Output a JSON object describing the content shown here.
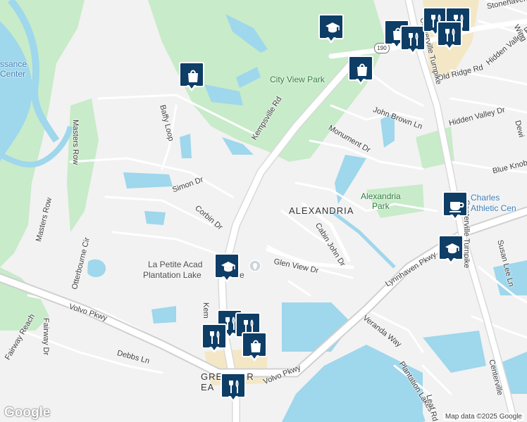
{
  "map": {
    "colors": {
      "water": "#9fd7ec",
      "park": "#c8ebc9",
      "road": "#ffffff",
      "highway": "#cfcfcf",
      "commercial": "#f3e7c6",
      "marker": "#0e3d66",
      "background": "#f2f2f2"
    },
    "route_badge": "190",
    "area_label": "ALEXANDRIA",
    "parks": {
      "city_view": "City View Park",
      "alexandria": "Alexandria\nPark"
    },
    "roads": {
      "kempsville": "Kempsville Rd",
      "kempsville_lower": "Kem",
      "john_brown": "John Brown Ln",
      "monument": "Monument Dr",
      "hidden_valley": "Hidden Valley Dr",
      "hidden_valley_top": "Hidden Valley Rd",
      "blue_knob": "Blue Knob",
      "old_ridge": "Old Ridge Rd",
      "stonehaven": "Stonehaven Dr",
      "wing": "Wing",
      "centerville_top": "Centerville Turnpike",
      "centerville_right": "Centerville Turnpike",
      "centerville_bottom": "Centerville",
      "lynnhaven": "Lynnhaven Pkwy",
      "susan_lee": "Susan Lee Ln",
      "cabin_john": "Cabin John Dr",
      "glen_view": "Glen View Dr",
      "veranda": "Veranda Way",
      "plantation": "Plantation Lakes",
      "leaf": "Leaf Rd",
      "volvo_left": "Volvo Pkwy",
      "volvo_right": "Volvo Pkwy",
      "debbs": "Debbs Ln",
      "fairway_reach": "Fairway Reach",
      "fairway_dr": "Fairway Dr",
      "masters_row_top": "Masters Row",
      "masters_row_bottom": "Masters Row",
      "otterbourne": "Otterbourne Cir",
      "simon": "Simon Dr",
      "corbin": "Corbin Dr",
      "baffy": "Baffy Loop",
      "dewi": "Dewi"
    },
    "pois": {
      "renaissance": "ssance\nCenter",
      "la_petite": "La Petite Acad",
      "plantation_lake": "Plantation Lake",
      "plantation_lake_tail": "e",
      "charles": "Charles\nAthletic Cen",
      "greenbrier": "GREENB",
      "greenbrier_tail": "IER",
      "east": "EA"
    },
    "markers": [
      {
        "name": "shopping-bag-marker",
        "icon": "shopping-bag-icon"
      },
      {
        "name": "school-marker",
        "icon": "graduation-cap-icon"
      },
      {
        "name": "shopping-bag-marker",
        "icon": "shopping-bag-icon"
      },
      {
        "name": "shopping-bag-marker",
        "icon": "shopping-bag-icon"
      },
      {
        "name": "restaurant-marker",
        "icon": "fork-knife-icon"
      },
      {
        "name": "restaurant-marker",
        "icon": "fork-knife-icon"
      },
      {
        "name": "restaurant-marker",
        "icon": "fork-knife-icon"
      },
      {
        "name": "restaurant-marker",
        "icon": "fork-knife-icon"
      },
      {
        "name": "cafe-marker",
        "icon": "coffee-cup-icon"
      },
      {
        "name": "school-marker",
        "icon": "graduation-cap-icon"
      },
      {
        "name": "school-marker",
        "icon": "graduation-cap-icon"
      },
      {
        "name": "restaurant-marker",
        "icon": "fork-knife-icon"
      },
      {
        "name": "restaurant-marker",
        "icon": "fork-knife-icon"
      },
      {
        "name": "restaurant-marker",
        "icon": "fork-knife-icon"
      },
      {
        "name": "shopping-bag-marker",
        "icon": "shopping-bag-icon"
      },
      {
        "name": "restaurant-marker",
        "icon": "fork-knife-icon"
      }
    ],
    "attribution": "Map data ©2025 Google",
    "logo": "Google"
  }
}
